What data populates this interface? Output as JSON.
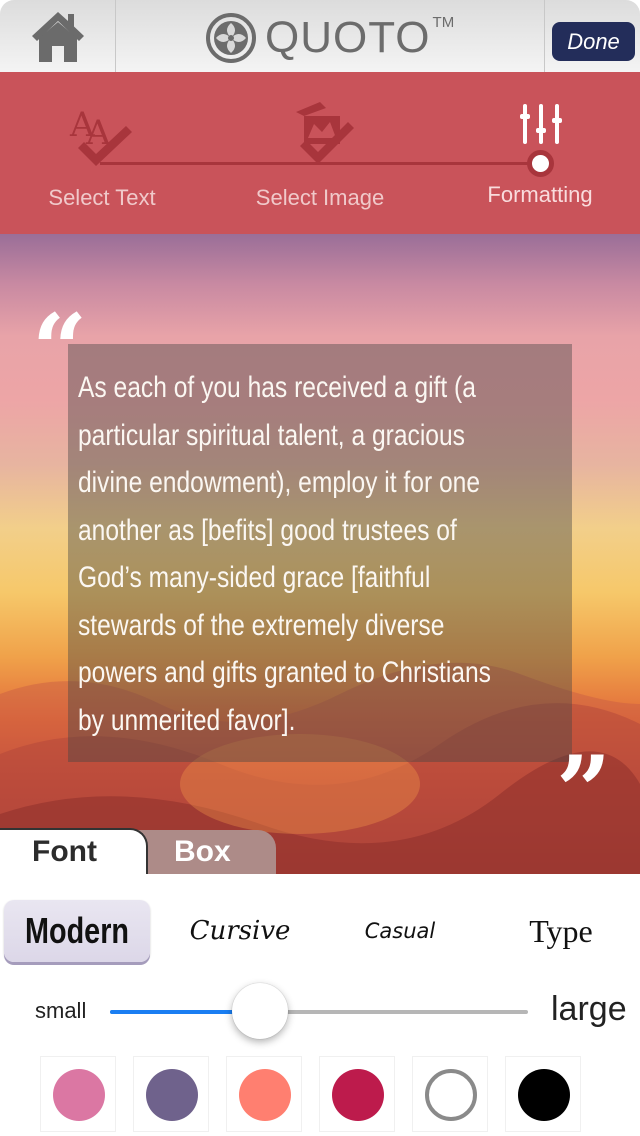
{
  "header": {
    "home_icon": "home-icon",
    "logo_icon": "quoto-swirl-icon",
    "app_name": "QUOTO",
    "trademark": "TM",
    "done_label": "Done"
  },
  "steps": [
    {
      "label": "Select Text",
      "icon": "text-aa-check-icon",
      "state": "complete"
    },
    {
      "label": "Select Image",
      "icon": "image-check-icon",
      "state": "complete"
    },
    {
      "label": "Formatting",
      "icon": "sliders-icon",
      "state": "active"
    }
  ],
  "preview": {
    "quote_open": "“",
    "quote_close": "”",
    "quote_lines": [
      "As each of you has received a gift (a",
      "particular spiritual talent, a gracious",
      "divine endowment), employ it for one",
      "another as [befits] good trustees of",
      "God’s many-sided grace [faithful",
      "stewards of the extremely diverse",
      "powers and gifts granted to Christians",
      "by unmerited favor]."
    ]
  },
  "tabs": [
    {
      "label": "Font",
      "selected": true
    },
    {
      "label": "Box",
      "selected": false
    }
  ],
  "font_options": [
    {
      "label": "Modern",
      "selected": true
    },
    {
      "label": "Cursive",
      "selected": false
    },
    {
      "label": "Casual",
      "selected": false
    },
    {
      "label": "Type",
      "selected": false
    }
  ],
  "size_slider": {
    "min_label": "small",
    "max_label": "large",
    "value_fraction": 0.36
  },
  "colors": [
    {
      "name": "pink",
      "hex": "#db77a3",
      "outline": false
    },
    {
      "name": "purple",
      "hex": "#6f628c",
      "outline": false
    },
    {
      "name": "salmon",
      "hex": "#ff7f70",
      "outline": false
    },
    {
      "name": "crimson",
      "hex": "#bd1b4c",
      "outline": false
    },
    {
      "name": "white",
      "hex": "#ffffff",
      "outline": true
    },
    {
      "name": "black",
      "hex": "#000000",
      "outline": false
    }
  ],
  "theme": {
    "steps_bg": "#c9535a",
    "done_bg": "#232d5a",
    "slider_fill": "#1a7ef2"
  }
}
